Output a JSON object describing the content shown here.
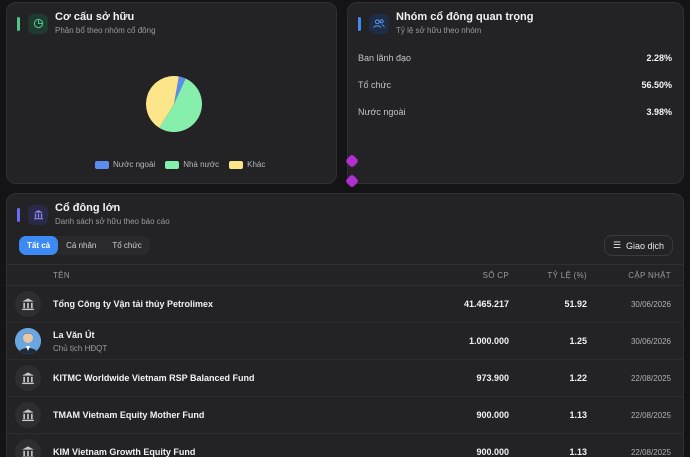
{
  "ownership": {
    "title": "Cơ cấu sở hữu",
    "subtitle": "Phân bổ theo nhóm cổ đông",
    "accent": "#4fc38a",
    "icon": "pie-chart-icon",
    "chart_data": {
      "type": "pie",
      "slices": [
        {
          "name": "Nước ngoài",
          "value": 4,
          "color": "#5b8def"
        },
        {
          "name": "Nhà nước",
          "value": 52,
          "color": "#86efac"
        },
        {
          "name": "Khác",
          "value": 44,
          "color": "#fde68a"
        }
      ],
      "legend": "bottom"
    }
  },
  "key_holders": {
    "title": "Nhóm cổ đông quan trọng",
    "subtitle": "Tỷ lệ sở hữu theo nhóm",
    "accent": "#3d8af5",
    "icon": "users-icon",
    "rows": [
      {
        "label": "Ban lãnh đạo",
        "value": "2.28%"
      },
      {
        "label": "Tổ chức",
        "value": "56.50%"
      },
      {
        "label": "Nước ngoài",
        "value": "3.98%"
      }
    ]
  },
  "major": {
    "title": "Cổ đông lớn",
    "subtitle": "Danh sách sở hữu theo báo cáo",
    "accent": "#6b6cf6",
    "icon": "bank-icon",
    "tabs": [
      "Tất cả",
      "Cá nhân",
      "Tổ chức"
    ],
    "trade_label": "Giao dịch",
    "columns": {
      "name": "TÊN",
      "shares": "SỐ CP",
      "ratio": "TỶ LỆ (%)",
      "updated": "CẬP NHẬT"
    },
    "rows": [
      {
        "name": "Tổng Công ty Vận tải thủy Petrolimex",
        "role": "",
        "shares": "41.465.217",
        "ratio": "51.92",
        "updated": "30/06/2026",
        "avatar": "bank-icon"
      },
      {
        "name": "La Văn Út",
        "role": "Chủ tịch HĐQT",
        "shares": "1.000.000",
        "ratio": "1.25",
        "updated": "30/06/2026",
        "avatar": "person-photo"
      },
      {
        "name": "KITMC Worldwide Vietnam RSP Balanced Fund",
        "role": "",
        "shares": "973.900",
        "ratio": "1.22",
        "updated": "22/08/2025",
        "avatar": "bank-icon"
      },
      {
        "name": "TMAM Vietnam Equity Mother Fund",
        "role": "",
        "shares": "900.000",
        "ratio": "1.13",
        "updated": "22/08/2025",
        "avatar": "bank-icon"
      },
      {
        "name": "KIM Vietnam Growth Equity Fund",
        "role": "",
        "shares": "900.000",
        "ratio": "1.13",
        "updated": "22/08/2025",
        "avatar": "bank-icon"
      }
    ]
  }
}
